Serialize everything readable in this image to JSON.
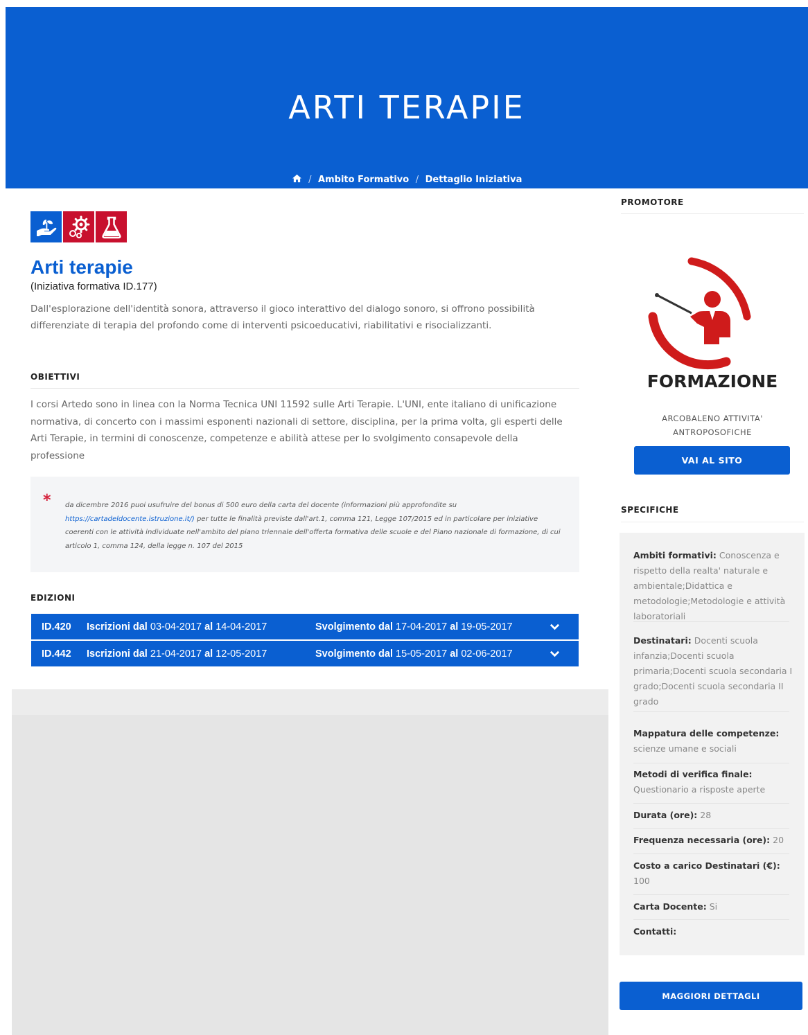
{
  "header": {
    "title": "ARTI TERAPIE",
    "breadcrumb": {
      "home_icon": "home-icon",
      "separator": "/",
      "items": [
        "Ambito Formativo",
        "Dettaglio Iniziativa"
      ]
    }
  },
  "initiative": {
    "category_icons": [
      {
        "icon": "hand-plant-icon",
        "color": "#0a5fd1"
      },
      {
        "icon": "gears-icon",
        "color": "#c8102e"
      },
      {
        "icon": "flask-icon",
        "color": "#c8102e"
      }
    ],
    "title": "Arti terapie",
    "subtitle": "(Iniziativa formativa ID.177)",
    "description": "Dall'esplorazione dell'identità sonora, attraverso il gioco interattivo del dialogo sonoro, si offrono possibilità differenziate di terapia del profondo come di interventi psicoeducativi, riabilitativi e risocializzanti.",
    "objectives_heading": "OBIETTIVI",
    "objectives_text": "I corsi Artedo sono in linea con la Norma Tecnica UNI 11592 sulle Arti Terapie. L'UNI, ente italiano di unificazione normativa, di concerto con i massimi esponenti nazionali di settore, disciplina, per la prima volta, gli esperti delle Arti Terapie, in termini di conoscenze, competenze e abilità attese per lo svolgimento consapevole della professione",
    "note": {
      "asterisk": "*",
      "text_before": "da dicembre 2016 puoi usufruire del bonus di 500 euro della carta del docente (informazioni più approfondite su",
      "link": "https://cartadeldocente.istruzione.it/)",
      "text_after": "per tutte le finalità previste dall'art.1, comma 121, Legge 107/2015 ed in particolare per iniziative coerenti con le attività individuate nell'ambito del piano triennale dell'offerta formativa delle scuole e del Piano nazionale di formazione, di cui articolo 1, comma 124, della legge n. 107 del 2015"
    },
    "editions_heading": "EDIZIONI",
    "editions": [
      {
        "id": "ID.420",
        "iscrizioni_label": "Iscrizioni dal",
        "iscrizioni_from": "03-04-2017",
        "iscrizioni_to_label": "al",
        "iscrizioni_to": "14-04-2017",
        "svolgimento_label": "Svolgimento dal",
        "svolgimento_from": "17-04-2017",
        "svolgimento_to_label": "al",
        "svolgimento_to": "19-05-2017"
      },
      {
        "id": "ID.442",
        "iscrizioni_label": "Iscrizioni dal",
        "iscrizioni_from": "21-04-2017",
        "iscrizioni_to_label": "al",
        "iscrizioni_to": "12-05-2017",
        "svolgimento_label": "Svolgimento dal",
        "svolgimento_from": "15-05-2017",
        "svolgimento_to_label": "al",
        "svolgimento_to": "02-06-2017"
      }
    ]
  },
  "sidebar": {
    "promoter_heading": "PROMOTORE",
    "logo_text": "FORMAZIONE",
    "org_name_line1": "ARCOBALENO ATTIVITA'",
    "org_name_line2": "ANTROPOSOFICHE",
    "site_button": "VAI AL SITO",
    "specs_heading": "SPECIFICHE",
    "specs": [
      {
        "key": "Ambiti formativi:",
        "value": "Conoscenza e rispetto della realta' naturale e ambientale;Didattica e metodologie;Metodologie e attività laboratoriali"
      },
      {
        "key": "Destinatari:",
        "value": "Docenti scuola infanzia;Docenti scuola primaria;Docenti scuola secondaria I grado;Docenti scuola secondaria II grado"
      },
      {
        "key": "Mappatura delle competenze:",
        "value": "scienze umane e sociali"
      },
      {
        "key": "Metodi di verifica finale:",
        "value": "Questionario a risposte aperte"
      },
      {
        "key": "Durata (ore):",
        "value": "28"
      },
      {
        "key": "Frequenza necessaria (ore):",
        "value": "20"
      },
      {
        "key": "Costo a carico Destinatari (€):",
        "value": "100"
      },
      {
        "key": "Carta Docente:",
        "value": "Si"
      },
      {
        "key": "Contatti:",
        "value": ""
      }
    ],
    "more_button": "MAGGIORI DETTAGLI"
  },
  "colors": {
    "primary_blue": "#0a5fd1",
    "accent_red": "#c8102e",
    "logo_red": "#cf1b1b"
  }
}
